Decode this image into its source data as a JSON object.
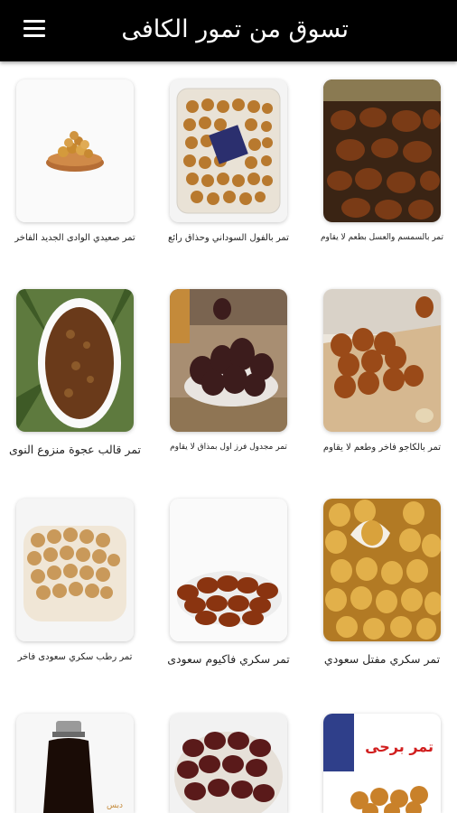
{
  "header": {
    "title": "تسوق من تمور الكافى",
    "menu_icon": "menu-icon"
  },
  "products": [
    {
      "name": "تمر صعيدي الوادى الجديد الفاخر"
    },
    {
      "name": "تمر بالفول السوداني وحذاق رائع"
    },
    {
      "name": "تمر بالسمسم والعسل بطعم لا يقاوم"
    },
    {
      "name": "تمر قالب عجوة منزوع النوى"
    },
    {
      "name": "تمر مجدول فرز اول بمذاق لا يقاوم"
    },
    {
      "name": "تمر بالكاجو فاخر وطعم لا يقاوم"
    },
    {
      "name": "تمر رطب سكري سعودى فاخر"
    },
    {
      "name": "تمر سكري فاكيوم سعودى"
    },
    {
      "name": "تمر سكري مفتل سعودي"
    },
    {
      "name": ""
    },
    {
      "name": ""
    },
    {
      "name": ""
    }
  ],
  "image_text": {
    "dibs_label": "دبس",
    "barhi_label": "تمر برحى"
  }
}
